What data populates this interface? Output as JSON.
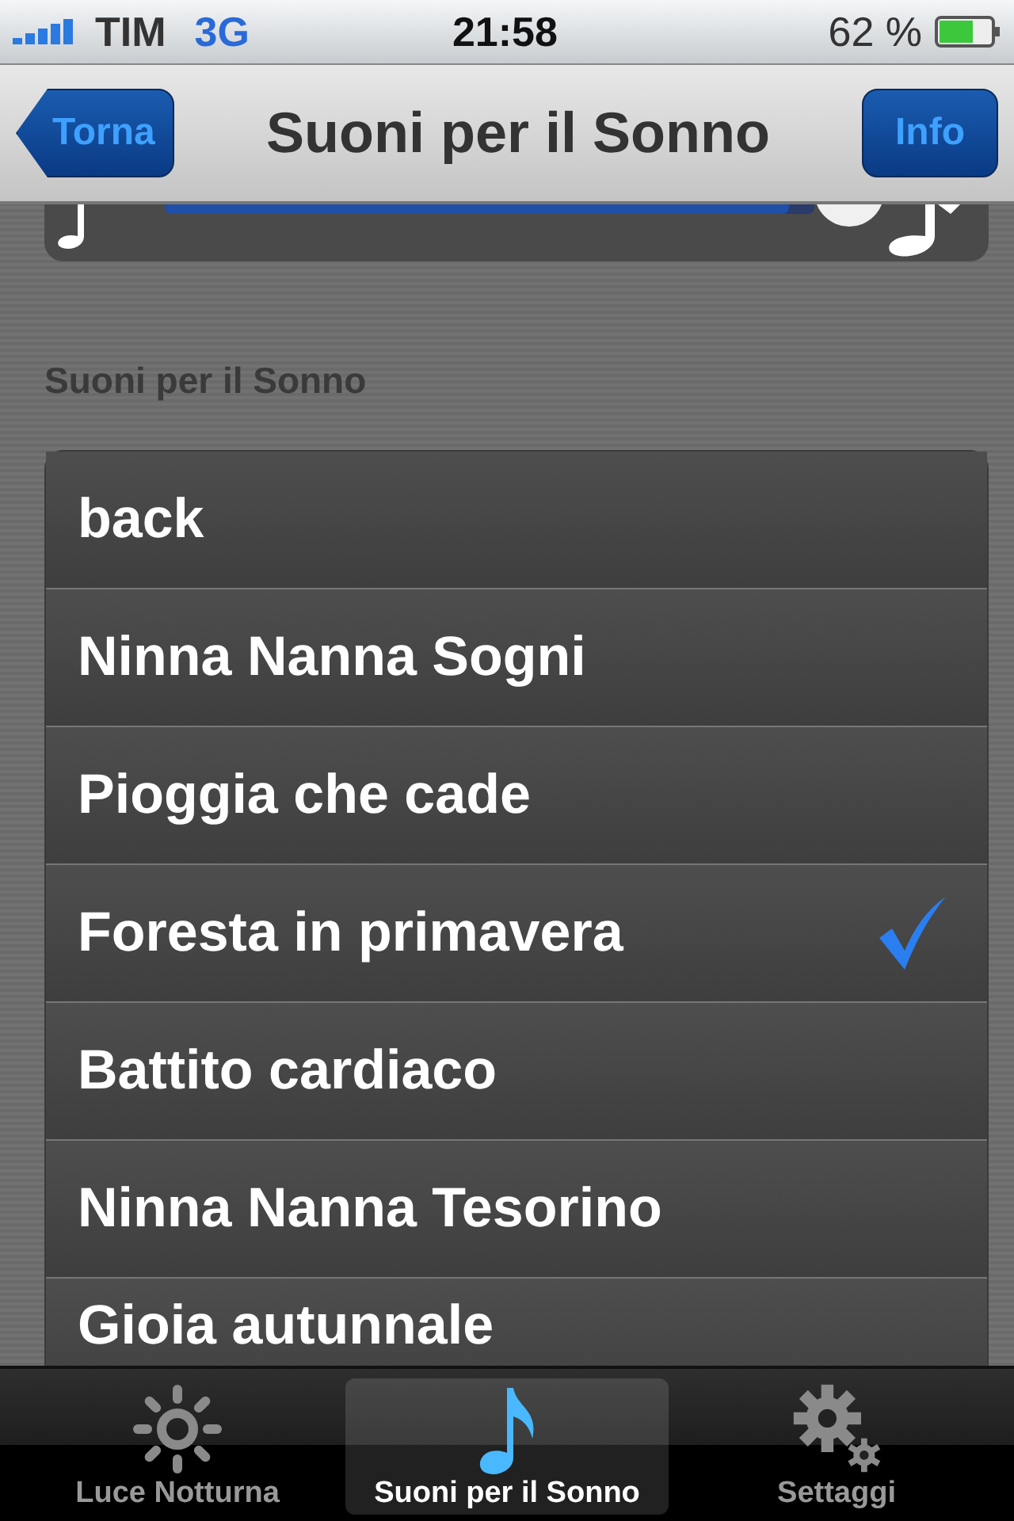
{
  "status_bar": {
    "carrier": "TIM",
    "network": "3G",
    "time": "21:58",
    "battery": "62 %"
  },
  "nav_bar": {
    "back_button": "Torna",
    "title": "Suoni per il Sonno",
    "right_button": "Info"
  },
  "volume": {
    "level": 0.96
  },
  "section_title": "Suoni per il Sonno",
  "sounds": [
    {
      "label": "back",
      "selected": false
    },
    {
      "label": "Ninna Nanna Sogni",
      "selected": false
    },
    {
      "label": "Pioggia che cade",
      "selected": false
    },
    {
      "label": "Foresta in primavera",
      "selected": true
    },
    {
      "label": "Battito cardiaco",
      "selected": false
    },
    {
      "label": "Ninna Nanna Tesorino",
      "selected": false
    },
    {
      "label": "Gioia autunnale",
      "selected": false
    }
  ],
  "tab_bar": [
    {
      "label": "Luce Notturna",
      "selected": false
    },
    {
      "label": "Suoni per il Sonno",
      "selected": true
    },
    {
      "label": "Settaggi",
      "selected": false
    }
  ]
}
